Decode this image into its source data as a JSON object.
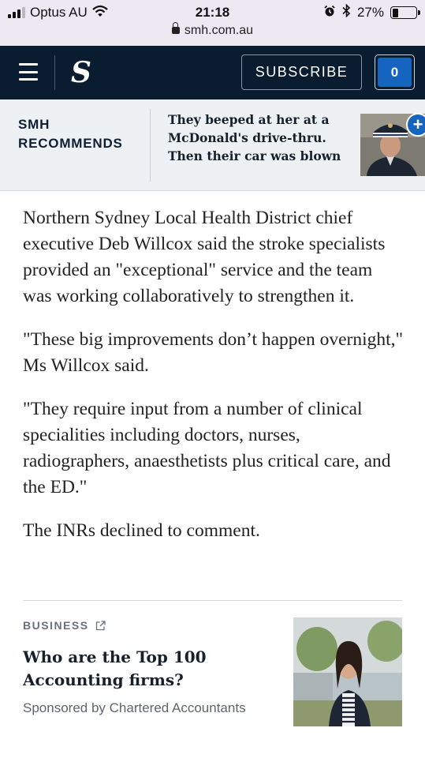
{
  "status_bar": {
    "carrier": "Optus AU",
    "time": "21:18",
    "battery": "27%",
    "battery_level": 0.27,
    "url": "smh.com.au",
    "icons": [
      "signal-icon",
      "wifi-icon",
      "alarm-icon",
      "bluetooth-icon",
      "battery-icon",
      "lock-icon"
    ]
  },
  "nav": {
    "logo": "S",
    "subscribe_label": "SUBSCRIBE",
    "counter": "0",
    "colors": {
      "background": "#0a1c2f",
      "counter": "#1565c0"
    }
  },
  "recommends": {
    "label": "SMH RECOMMENDS",
    "story_title": "They beeped at her at a McDonald's drive-thru. Then their car was blown",
    "plus_label": "+"
  },
  "article": {
    "paragraphs": [
      "Northern Sydney Local Health District chief executive Deb Willcox said the stroke specialists provided an \"exceptional\" service and the team was working collaboratively to strengthen it.",
      "\"These big improvements don’t happen overnight,\" Ms Willcox said.",
      "\"They require input from a number of clinical specialities including doctors, nurses, radiographers, anaesthetists plus critical care, and the ED.\"",
      "The INRs declined to comment."
    ]
  },
  "sponsored": {
    "category": "BUSINESS",
    "title": "Who are the Top 100 Accounting firms?",
    "sponsor": "Sponsored by Chartered Accountants"
  }
}
